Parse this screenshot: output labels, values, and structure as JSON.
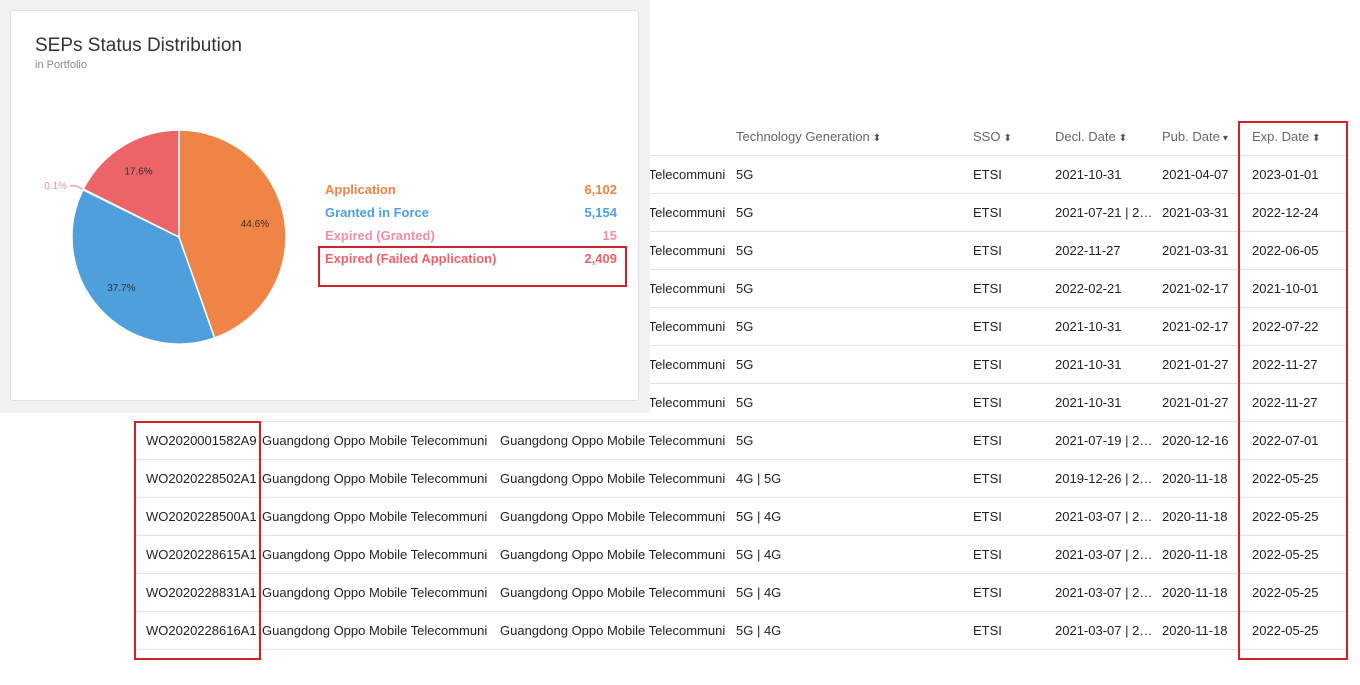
{
  "card": {
    "title": "SEPs Status Distribution",
    "subtitle": "in Portfolio"
  },
  "chart_data": {
    "type": "pie",
    "categories": [
      "Application",
      "Granted in Force",
      "Expired (Granted)",
      "Expired (Failed Application)"
    ],
    "values": [
      6102,
      5154,
      15,
      2409
    ],
    "value_labels": [
      "6,102",
      "5,154",
      "15",
      "2,409"
    ],
    "percent_labels": [
      "44.6%",
      "37.7%",
      "0.1%",
      "17.6%"
    ],
    "colors": [
      "#ee8445",
      "#4e9fdc",
      "#ee8fa6",
      "#ec6468"
    ],
    "legend_placement": "right"
  },
  "table": {
    "headers": {
      "tech": "Technology Generation",
      "sso": "SSO",
      "decl": "Decl. Date",
      "pub": "Pub. Date",
      "exp": "Exp. Date"
    },
    "sort_icons": {
      "tech": "⬍",
      "sso": "⬍",
      "decl": "⬍",
      "pub": "▾",
      "exp": "⬍"
    },
    "rows": [
      {
        "id": "",
        "assignee": "",
        "applicant": "Guangdong Oppo Mobile Telecommuni",
        "tech": "5G",
        "sso": "ETSI",
        "decl": "2021-10-31",
        "pub": "2021-04-07",
        "exp": "2023-01-01"
      },
      {
        "id": "",
        "assignee": "",
        "applicant": "Guangdong Oppo Mobile Telecommuni",
        "tech": "5G",
        "sso": "ETSI",
        "decl": "2021-07-21 | 20...",
        "pub": "2021-03-31",
        "exp": "2022-12-24"
      },
      {
        "id": "",
        "assignee": "",
        "applicant": "Guangdong Oppo Mobile Telecommuni",
        "tech": "5G",
        "sso": "ETSI",
        "decl": "2022-11-27",
        "pub": "2021-03-31",
        "exp": "2022-06-05"
      },
      {
        "id": "",
        "assignee": "",
        "applicant": "Guangdong Oppo Mobile Telecommuni",
        "tech": "5G",
        "sso": "ETSI",
        "decl": "2022-02-21",
        "pub": "2021-02-17",
        "exp": "2021-10-01"
      },
      {
        "id": "",
        "assignee": "",
        "applicant": "Guangdong Oppo Mobile Telecommuni",
        "tech": "5G",
        "sso": "ETSI",
        "decl": "2021-10-31",
        "pub": "2021-02-17",
        "exp": "2022-07-22"
      },
      {
        "id": "",
        "assignee": "",
        "applicant": "Guangdong Oppo Mobile Telecommuni",
        "tech": "5G",
        "sso": "ETSI",
        "decl": "2021-10-31",
        "pub": "2021-01-27",
        "exp": "2022-11-27"
      },
      {
        "id": "",
        "assignee": "",
        "applicant": "Guangdong Oppo Mobile Telecommuni",
        "tech": "5G",
        "sso": "ETSI",
        "decl": "2021-10-31",
        "pub": "2021-01-27",
        "exp": "2022-11-27"
      },
      {
        "id": "WO2020001582A9",
        "assignee": "Guangdong Oppo Mobile Telecommuni",
        "applicant": "Guangdong Oppo Mobile Telecommuni",
        "tech": "5G",
        "sso": "ETSI",
        "decl": "2021-07-19 | 20...",
        "pub": "2020-12-16",
        "exp": "2022-07-01"
      },
      {
        "id": "WO2020228502A1",
        "assignee": "Guangdong Oppo Mobile Telecommuni",
        "applicant": "Guangdong Oppo Mobile Telecommuni",
        "tech": "4G | 5G",
        "sso": "ETSI",
        "decl": "2019-12-26 | 20...",
        "pub": "2020-11-18",
        "exp": "2022-05-25"
      },
      {
        "id": "WO2020228500A1",
        "assignee": "Guangdong Oppo Mobile Telecommuni",
        "applicant": "Guangdong Oppo Mobile Telecommuni",
        "tech": "5G | 4G",
        "sso": "ETSI",
        "decl": "2021-03-07 | 20...",
        "pub": "2020-11-18",
        "exp": "2022-05-25"
      },
      {
        "id": "WO2020228615A1",
        "assignee": "Guangdong Oppo Mobile Telecommuni",
        "applicant": "Guangdong Oppo Mobile Telecommuni",
        "tech": "5G | 4G",
        "sso": "ETSI",
        "decl": "2021-03-07 | 20...",
        "pub": "2020-11-18",
        "exp": "2022-05-25"
      },
      {
        "id": "WO2020228831A1",
        "assignee": "Guangdong Oppo Mobile Telecommuni",
        "applicant": "Guangdong Oppo Mobile Telecommuni",
        "tech": "5G | 4G",
        "sso": "ETSI",
        "decl": "2021-03-07 | 20...",
        "pub": "2020-11-18",
        "exp": "2022-05-25"
      },
      {
        "id": "WO2020228616A1",
        "assignee": "Guangdong Oppo Mobile Telecommuni",
        "applicant": "Guangdong Oppo Mobile Telecommuni",
        "tech": "5G | 4G",
        "sso": "ETSI",
        "decl": "2021-03-07 | 20...",
        "pub": "2020-11-18",
        "exp": "2022-05-25"
      }
    ]
  }
}
